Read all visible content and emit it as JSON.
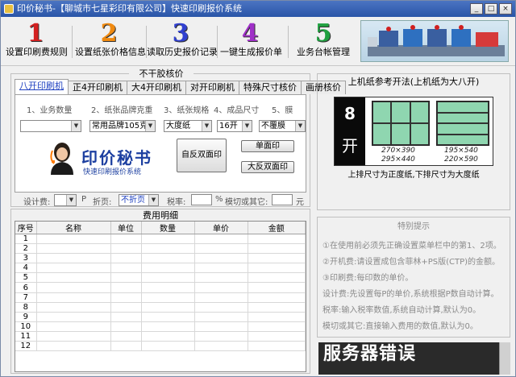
{
  "window": {
    "title": "印价秘书-【聊城市七星彩印有限公司】快速印刷报价系统"
  },
  "toolbar": {
    "items": [
      {
        "num": "1",
        "label": "设置印刷费规则",
        "color": "#d42020"
      },
      {
        "num": "2",
        "label": "设置纸张价格信息",
        "color": "#f08a10"
      },
      {
        "num": "3",
        "label": "读取历史报价记录",
        "color": "#3040d0"
      },
      {
        "num": "4",
        "label": "一键生成报价单",
        "color": "#a030c8"
      },
      {
        "num": "5",
        "label": "业务台帐管理",
        "color": "#20a040"
      }
    ]
  },
  "quote": {
    "title": "不干胶核价",
    "tabs": [
      "八开印刷机",
      "正4开印刷机",
      "大4开印刷机",
      "对开印刷机",
      "特殊尺寸核价",
      "画册核价"
    ],
    "fields": [
      {
        "label": "1、业务数量",
        "value": ""
      },
      {
        "label": "2、纸张品牌克重",
        "value": "常用品牌105克"
      },
      {
        "label": "3、纸张规格",
        "value": "大度纸"
      },
      {
        "label": "4、成品尺寸",
        "value": "16开"
      },
      {
        "label": "5、膜",
        "value": "不覆膜"
      }
    ],
    "brand": {
      "title": "印价秘书",
      "subtitle": "快速印刷报价系统"
    },
    "buttons": {
      "duplex": "自反双面印",
      "single": "单面印",
      "big_duplex": "大反双面印"
    },
    "bottom": {
      "designer": "设计费:",
      "p": "P",
      "fold": "折页:",
      "fold_value": "不折页",
      "tax": "税率:",
      "percent": "%",
      "die": "模切或其它:",
      "yuan": "元"
    }
  },
  "cost": {
    "title": "费用明细",
    "columns": [
      "序号",
      "名称",
      "单位",
      "数量",
      "单价",
      "金额"
    ],
    "rows": [
      "1",
      "2",
      "3",
      "4",
      "5",
      "6",
      "7",
      "8",
      "9",
      "10",
      "11",
      "12"
    ]
  },
  "reference": {
    "title": "上机纸参考开法(上机纸为大八开)",
    "big_num": "8",
    "big_char": "开",
    "dim1a": "270×390",
    "dim1b": "295×440",
    "dim2a": "195×540",
    "dim2b": "220×590",
    "caption": "上排尺寸为正度纸,下排尺寸为大度纸"
  },
  "tips": {
    "title": "特别提示",
    "lines": [
      "①在使用前必须先正确设置菜单栏中的第1、2项。",
      "②开机费:请设置成包含菲林+PS版(CTP)的金额。",
      "③印刷费:每印数的单价。",
      "设计费:先设置每P的单价,系统根据P数自动计算。",
      "税率:输入税率数值,系统自动计算,默认为0。",
      "模切或其它:直接输入费用的数值,默认为0。"
    ]
  },
  "error": {
    "text": "服务器错误"
  }
}
